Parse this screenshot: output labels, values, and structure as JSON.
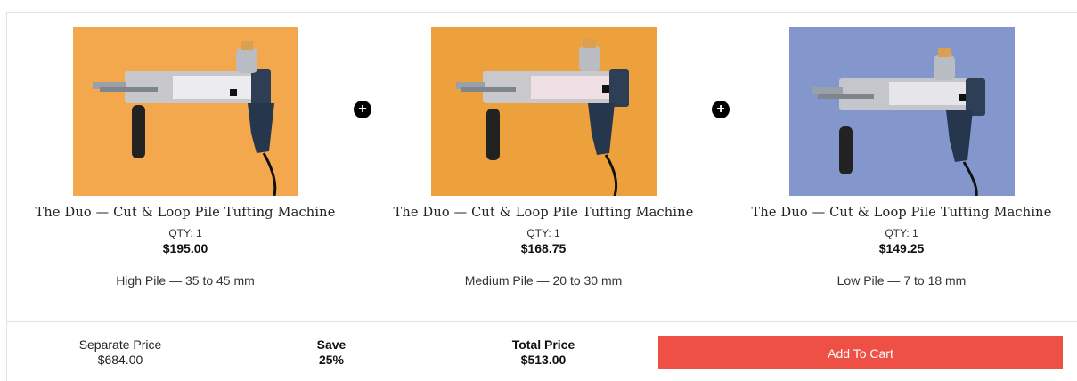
{
  "products": [
    {
      "title": "The Duo — Cut & Loop Pile Tufting Machine",
      "qty": "QTY: 1",
      "price": "$195.00",
      "variant": "High Pile — 35 to 45 mm",
      "bg_color": "#f3a84e",
      "image_icon": "tufting-gun-photo"
    },
    {
      "title": "The Duo — Cut & Loop Pile Tufting Machine",
      "qty": "QTY: 1",
      "price": "$168.75",
      "variant": "Medium Pile — 20 to 30 mm",
      "bg_color": "#eda13c",
      "image_icon": "tufting-gun-photo"
    },
    {
      "title": "The Duo — Cut & Loop Pile Tufting Machine",
      "qty": "QTY: 1",
      "price": "$149.25",
      "variant": "Low Pile — 7 to 18 mm",
      "bg_color": "#8497cc",
      "image_icon": "tufting-gun-photo"
    }
  ],
  "plus_icon": "+",
  "summary": {
    "separate_label": "Separate Price",
    "separate_value": "$684.00",
    "save_label": "Save",
    "save_value": "25%",
    "total_label": "Total Price",
    "total_value": "$513.00"
  },
  "cart_button": {
    "label": "Add To Cart",
    "color": "#ef5045"
  }
}
